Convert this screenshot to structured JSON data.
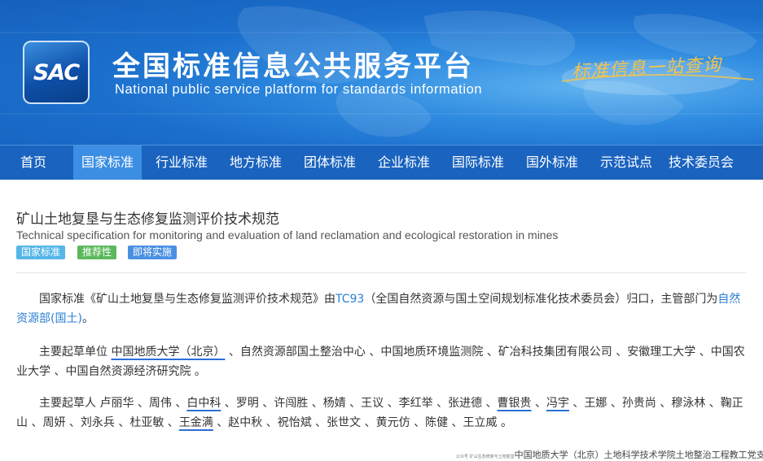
{
  "header": {
    "logo_text": "SAC",
    "title": "全国标准信息公共服务平台",
    "subtitle": "National public service platform  for standards information",
    "slogan": "标准信息一站查询"
  },
  "nav": {
    "items": [
      {
        "label": "首页"
      },
      {
        "label": "国家标准"
      },
      {
        "label": "行业标准"
      },
      {
        "label": "地方标准"
      },
      {
        "label": "团体标准"
      },
      {
        "label": "企业标准"
      },
      {
        "label": "国际标准"
      },
      {
        "label": "国外标准"
      },
      {
        "label": "示范试点"
      },
      {
        "label": "技术委员会"
      }
    ],
    "active": "国家标准"
  },
  "standard": {
    "title_cn": "矿山土地复垦与生态修复监测评价技术规范",
    "title_en": "Technical specification for monitoring and evaluation of land reclamation and ecological restoration in mines",
    "badges": [
      {
        "label": "国家标准",
        "color": "#56b6e8"
      },
      {
        "label": "推荐性",
        "color": "#5cb85c"
      },
      {
        "label": "即将实施",
        "color": "#4a90e2"
      }
    ],
    "desc": {
      "prefix": "国家标准《矿山土地复垦与生态修复监测评价技术规范》由",
      "tc_link": "TC93",
      "middle": "（全国自然资源与国土空间规划标准化技术委员会）归口，主管部门为",
      "dept_link": "自然资源部(国土)",
      "suffix": "。"
    },
    "units": {
      "label": "主要起草单位",
      "items": [
        "中国地质大学（北京）",
        "自然资源部国土整治中心",
        "中国地质环境监测院",
        "矿冶科技集团有限公司",
        "安徽理工大学",
        "中国农业大学",
        "中国自然资源经济研究院"
      ],
      "end": "。"
    },
    "drafters": {
      "label": "主要起草人",
      "items": [
        "卢丽华",
        "周伟",
        "白中科",
        "罗明",
        "许闯胜",
        "杨婧",
        "王议",
        "李红举",
        "张进德",
        "曹银贵",
        "冯宇",
        "王娜",
        "孙贵尚",
        "穆泳林",
        "鞠正山",
        "周妍",
        "刘永兵",
        "杜亚敏",
        "王金满",
        "赵中秋",
        "祝怡斌",
        "张世文",
        "黄元仿",
        "陈健",
        "王立威"
      ],
      "end": "。"
    }
  },
  "footnote": {
    "small": "公众号 矿山生态修复与土地复垦",
    "text": "中国地质大学（北京）土地科学技术学院土地整治工程教工党支部"
  },
  "colors": {
    "nav_bg": "#1a63bf",
    "nav_active": "#3b8ee3",
    "link": "#2b7fd1",
    "underline": "#2b6fd8"
  }
}
